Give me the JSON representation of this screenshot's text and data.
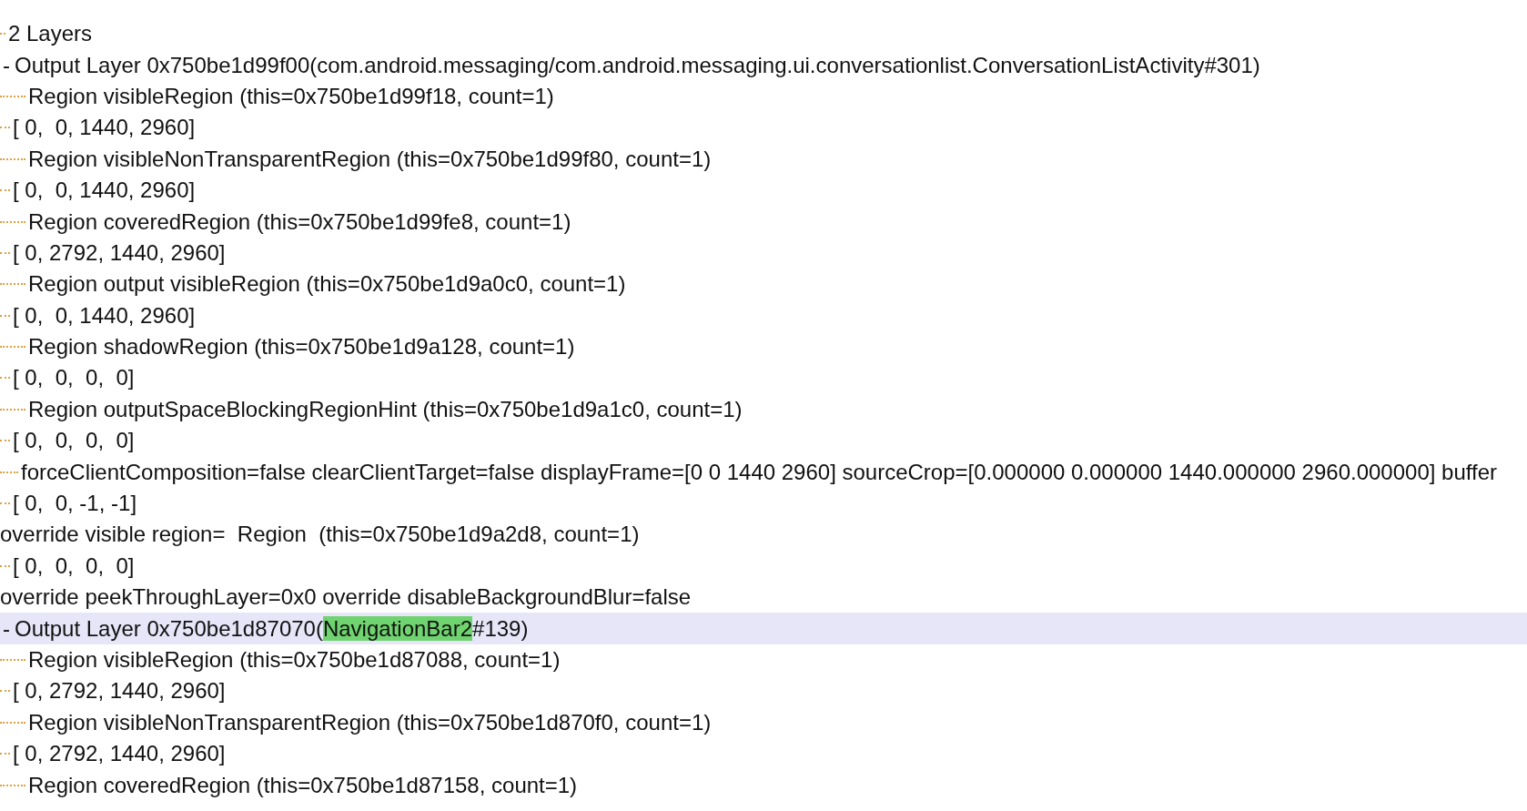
{
  "lines": [
    {
      "kind": "header",
      "selected": false,
      "text": "2 Layers"
    },
    {
      "kind": "layer",
      "selected": false,
      "marker": "-",
      "segments": [
        {
          "text": "Output Layer 0x750be1d99f00(com.android.messaging/com.android.messaging.ui.conversationlist.ConversationListActivity#301)",
          "highlighted": false
        }
      ]
    },
    {
      "kind": "region",
      "selected": false,
      "text": "Region visibleRegion (this=0x750be1d99f18, count=1)"
    },
    {
      "kind": "rect",
      "selected": false,
      "text": "[ 0,  0, 1440, 2960]"
    },
    {
      "kind": "region",
      "selected": false,
      "text": "Region visibleNonTransparentRegion (this=0x750be1d99f80, count=1)"
    },
    {
      "kind": "rect",
      "selected": false,
      "text": "[ 0,  0, 1440, 2960]"
    },
    {
      "kind": "region",
      "selected": false,
      "text": "Region coveredRegion (this=0x750be1d99fe8, count=1)"
    },
    {
      "kind": "rect",
      "selected": false,
      "text": "[ 0, 2792, 1440, 2960]"
    },
    {
      "kind": "region",
      "selected": false,
      "text": "Region output visibleRegion (this=0x750be1d9a0c0, count=1)"
    },
    {
      "kind": "rect",
      "selected": false,
      "text": "[ 0,  0, 1440, 2960]"
    },
    {
      "kind": "region",
      "selected": false,
      "text": "Region shadowRegion (this=0x750be1d9a128, count=1)"
    },
    {
      "kind": "rect",
      "selected": false,
      "text": "[ 0,  0,  0,  0]"
    },
    {
      "kind": "region",
      "selected": false,
      "text": "Region outputSpaceBlockingRegionHint (this=0x750be1d9a1c0, count=1)"
    },
    {
      "kind": "rect",
      "selected": false,
      "text": "[ 0,  0,  0,  0]"
    },
    {
      "kind": "detail",
      "selected": false,
      "text": "forceClientComposition=false clearClientTarget=false displayFrame=[0 0 1440 2960] sourceCrop=[0.000000 0.000000 1440.000000 2960.000000] buffer"
    },
    {
      "kind": "rect",
      "selected": false,
      "text": "[ 0,  0, -1, -1]"
    },
    {
      "kind": "override",
      "selected": false,
      "text": "override visible region=  Region  (this=0x750be1d9a2d8, count=1)"
    },
    {
      "kind": "rect",
      "selected": false,
      "text": "[ 0,  0,  0,  0]"
    },
    {
      "kind": "override",
      "selected": false,
      "text": "override peekThroughLayer=0x0 override disableBackgroundBlur=false"
    },
    {
      "kind": "layer",
      "selected": true,
      "marker": "-",
      "segments": [
        {
          "text": "Output Layer 0x750be1d87070(",
          "highlighted": false
        },
        {
          "text": "NavigationBar2",
          "highlighted": true
        },
        {
          "text": "#139)",
          "highlighted": false
        }
      ]
    },
    {
      "kind": "region",
      "selected": false,
      "text": "Region visibleRegion (this=0x750be1d87088, count=1)"
    },
    {
      "kind": "rect",
      "selected": false,
      "text": "[ 0, 2792, 1440, 2960]"
    },
    {
      "kind": "region",
      "selected": false,
      "text": "Region visibleNonTransparentRegion (this=0x750be1d870f0, count=1)"
    },
    {
      "kind": "rect",
      "selected": false,
      "text": "[ 0, 2792, 1440, 2960]"
    },
    {
      "kind": "region",
      "selected": false,
      "text": "Region coveredRegion (this=0x750be1d87158, count=1)"
    }
  ]
}
